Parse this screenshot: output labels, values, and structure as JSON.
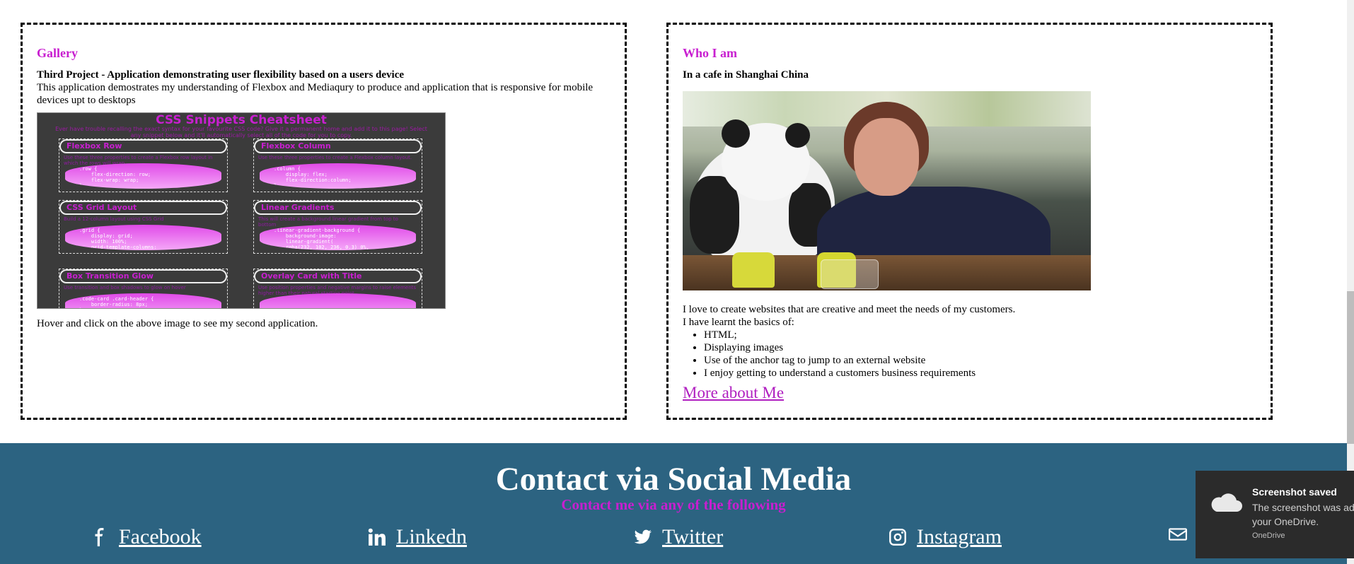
{
  "gallery": {
    "title": "Gallery",
    "project_title": "Third Project - Application demonstrating user flexibility based on a users device",
    "description": "This application demostrates my understanding of Flexbox and Mediaqury to produce and application that is responsive for mobile devices upt to desktops",
    "note": "Hover and click on the above image to see my second application.",
    "cheatsheet": {
      "title": "CSS Snippets Cheatsheet",
      "subtitle": "Ever have trouble recalling the exact syntax for your favourite CSS code? Give it a permanent home and add it to this page! Select any snippet below and it'll automatically select all of the code for you to copy.",
      "boxes": [
        {
          "label": "Flexbox Row",
          "desc": "Use these three properties to create a Flexbox row layout in which the rows will wrap.",
          "code": ".row {\n    flex-direction: row;\n    flex-wrap: wrap;\n}"
        },
        {
          "label": "Flexbox Column",
          "desc": "Use these three properties to create a Flexbox column layout.",
          "code": ".column {\n    display: flex;\n    flex-direction:column;\n}"
        },
        {
          "label": "CSS Grid Layout",
          "desc": "Build a 12-column layout using CSS Grid",
          "code": ".grid {\n    display: grid;\n    width: 100%;\n    grid-template-columns:\n    repeat(12, 1fr);\n}"
        },
        {
          "label": "Linear Gradients",
          "desc": "This will create a background linear gradient from top to bottom",
          "code": ".linear-gradient-background {\n    background-image:\n    linear-gradient(\n    rgba(232, 102, 236, 0.3) 0%,\n    rgba(232, 102, 236, 0.6) 100%);\n}"
        },
        {
          "label": "Box Transition Glow",
          "desc": "Use transition and box shadows to glow on hover",
          "code": ".code-card .card-header {\n    border-radius: 8px;\n}"
        },
        {
          "label": "Overlay Card with Title",
          "desc": "Use position properties and negative margins to raise elements higher than their natural starting point.",
          "code": ""
        }
      ]
    }
  },
  "whoami": {
    "title": "Who I am",
    "subtitle": "In a cafe in Shanghai China",
    "about_line1": "I love to create websites that are creative and meet the needs of my customers.",
    "about_line2": "I have learnt the basics of:",
    "skills": [
      "HTML;",
      "Displaying images",
      "Use of the anchor tag to jump to an external website",
      "I enjoy getting to understand a customers business requirements"
    ],
    "more_link": "More about Me"
  },
  "footer": {
    "title": "Contact via Social Media",
    "subtitle": "Contact me via any of the following",
    "links": {
      "facebook": "Facebook",
      "linkedin": "Linkedn",
      "twitter": "Twitter",
      "instagram": "Instagram"
    }
  },
  "toast": {
    "title": "Screenshot saved",
    "body": "The screenshot was added to your OneDrive.",
    "app": "OneDrive"
  },
  "colors": {
    "accent": "#c81fd0",
    "footer_bg": "#2c6381",
    "toast_bg": "#2b2b2b"
  }
}
